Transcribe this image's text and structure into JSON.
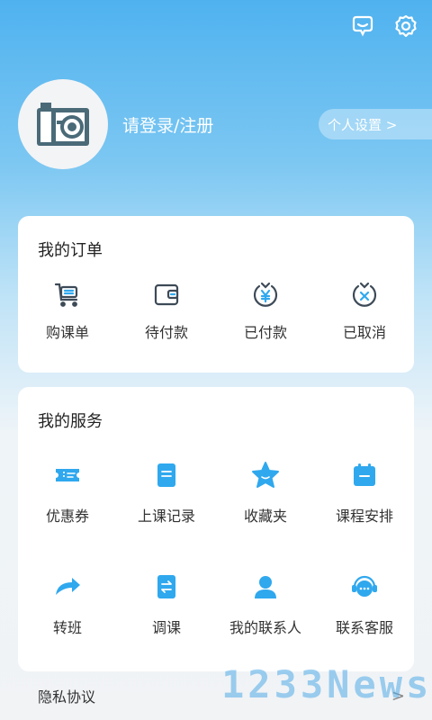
{
  "header": {
    "icons": [
      "message-bubble-icon",
      "settings-gear-icon"
    ]
  },
  "profile": {
    "login_text": "请登录/注册",
    "settings_label": "个人设置 >"
  },
  "orders": {
    "title": "我的订单",
    "items": [
      {
        "label": "购课单",
        "icon": "cart-icon"
      },
      {
        "label": "待付款",
        "icon": "wallet-icon"
      },
      {
        "label": "已付款",
        "icon": "yen-paid-icon"
      },
      {
        "label": "已取消",
        "icon": "cancelled-icon"
      }
    ]
  },
  "services": {
    "title": "我的服务",
    "items": [
      {
        "label": "优惠券",
        "icon": "coupon-icon"
      },
      {
        "label": "上课记录",
        "icon": "record-icon"
      },
      {
        "label": "收藏夹",
        "icon": "star-icon"
      },
      {
        "label": "课程安排",
        "icon": "calendar-icon"
      },
      {
        "label": "转班",
        "icon": "transfer-arrow-icon"
      },
      {
        "label": "调课",
        "icon": "swap-icon"
      },
      {
        "label": "我的联系人",
        "icon": "contact-person-icon"
      },
      {
        "label": "联系客服",
        "icon": "customer-service-icon"
      }
    ]
  },
  "privacy": {
    "label": "隐私协议",
    "chevron": ">"
  },
  "watermark": "1233News",
  "colors": {
    "accent": "#2fa8ee",
    "header_blue": "#4fb2ef",
    "icon_dark": "#3d4a57"
  }
}
